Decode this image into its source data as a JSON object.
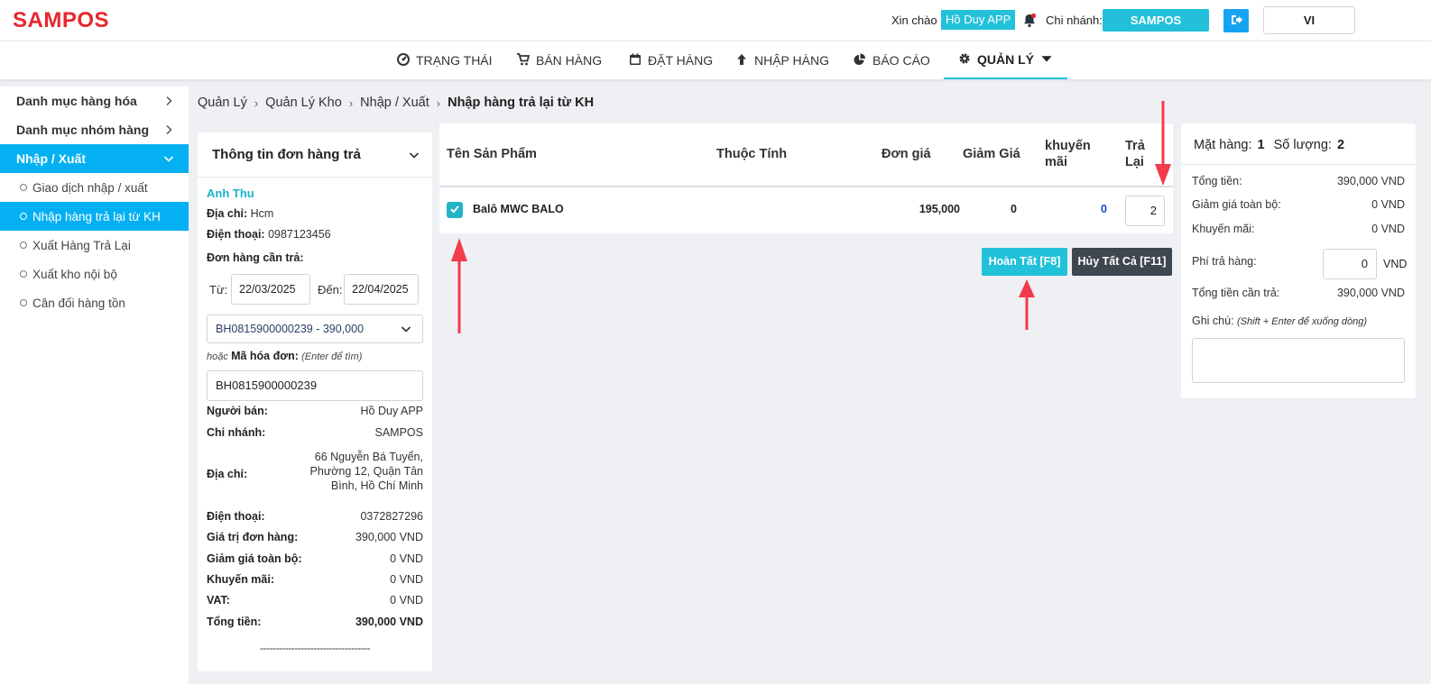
{
  "header": {
    "logo": "SAMPOS",
    "greeting": "Xin chào",
    "user": "Hồ Duy APP",
    "branch_label": "Chi nhánh:",
    "branch": "SAMPOS",
    "language": "VI"
  },
  "nav": [
    {
      "label": "Trạng thái",
      "icon": "dashboard-icon"
    },
    {
      "label": "Bán hàng",
      "icon": "cart-icon"
    },
    {
      "label": "Đặt hàng",
      "icon": "calendar-icon"
    },
    {
      "label": "Nhập hàng",
      "icon": "arrow-up-icon"
    },
    {
      "label": "Báo cáo",
      "icon": "pie-chart-icon"
    },
    {
      "label": "Quản lý",
      "icon": "gear-icon",
      "active": true
    }
  ],
  "sidebar": {
    "items": [
      {
        "label": "Danh mục hàng hóa"
      },
      {
        "label": "Danh mục nhóm hàng"
      },
      {
        "label": "Nhập / Xuất",
        "open": true
      }
    ],
    "sub_items": [
      {
        "label": "Giao dịch nhập / xuất"
      },
      {
        "label": "Nhập hàng trả lại từ KH",
        "active": true
      },
      {
        "label": "Xuất Hàng Trả Lại"
      },
      {
        "label": "Xuất kho nội bộ"
      },
      {
        "label": "Cân đối hàng tồn"
      }
    ]
  },
  "breadcrumb": [
    "Quản Lý",
    "Quản Lý Kho",
    "Nhập / Xuất",
    "Nhập hàng trả lại từ KH"
  ],
  "order_info": {
    "title": "Thông tin đơn hàng trả",
    "customer": "Anh Thu",
    "address_label": "Địa chỉ:",
    "address": "Hcm",
    "phone_label": "Điện thoại:",
    "phone": "0987123456",
    "order_label": "Đơn hàng cần trả:",
    "from_label": "Từ:",
    "from_date": "22/03/2025",
    "to_label": "Đến:",
    "to_date": "22/04/2025",
    "selected_order": "BH0815900000239 - 390,000",
    "or_text": "hoặc",
    "code_label": "Mã hóa đơn:",
    "code_hint": "(Enter để tìm)",
    "code_value": "BH0815900000239",
    "seller_label": "Người bán:",
    "seller": "Hồ Duy APP",
    "branch_label": "Chi nhánh:",
    "branch": "SAMPOS",
    "store_address_label": "Địa chỉ:",
    "store_address": "66 Nguyễn Bá Tuyển, Phường 12, Quận Tân Bình, Hồ Chí Minh",
    "store_phone_label": "Điện thoại:",
    "store_phone": "0372827296",
    "order_value_label": "Giá trị đơn hàng:",
    "order_value": "390,000 VND",
    "discount_label": "Giảm giá toàn bộ:",
    "discount": "0 VND",
    "promo_label": "Khuyến mãi:",
    "promo": "0 VND",
    "vat_label": "VAT:",
    "vat": "0 VND",
    "total_label": "Tổng tiền:",
    "total": "390,000 VND",
    "divider": "-----------------------------------"
  },
  "table": {
    "headers": [
      "Tên Sản Phẩm",
      "Thuộc Tính",
      "Đơn giá",
      "Giảm Giá",
      "khuyến mãi",
      "Trả Lại"
    ],
    "rows": [
      {
        "checked": true,
        "name": "Balô MWC BALO",
        "attribute": "",
        "price": "195,000",
        "discount": "0",
        "promo": "0",
        "return_qty": "2"
      }
    ]
  },
  "actions": {
    "done": "Hoàn Tất [F8]",
    "cancel": "Hủy Tất Cả [F11]"
  },
  "summary": {
    "items_label": "Mặt hàng:",
    "items": "1",
    "qty_label": "Số lượng:",
    "qty": "2",
    "total_label": "Tổng tiền:",
    "total": "390,000 VND",
    "discount_label": "Giảm giá toàn bộ:",
    "discount": "0 VND",
    "promo_label": "Khuyến mãi:",
    "promo": "0 VND",
    "fee_label": "Phí trả hàng:",
    "fee": "0",
    "fee_unit": "VND",
    "refund_label": "Tổng tiền cần trả:",
    "refund": "390,000 VND",
    "note_label": "Ghi chú:",
    "note_hint": "(Shift + Enter để xuống dòng)"
  },
  "colors": {
    "brand": "#e8262d",
    "accent": "#22c1d9",
    "sidebar_active": "#05b0f2",
    "annotation": "#f23b4b"
  }
}
